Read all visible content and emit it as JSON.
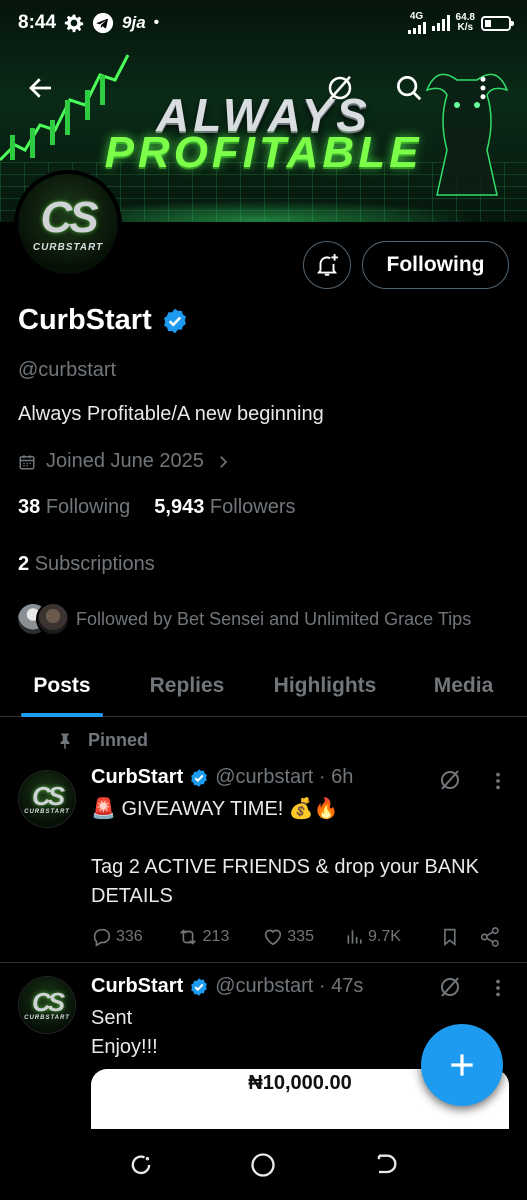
{
  "status_bar": {
    "time": "8:44",
    "app_badge": "9ja",
    "dot": "•",
    "network_top": "4G",
    "speed_value": "64.8",
    "speed_unit": "K/s",
    "icons": [
      "gear-icon",
      "telegram-icon",
      "signal-icon",
      "battery-icon"
    ]
  },
  "header": {
    "banner_line1": "ALWAYS",
    "banner_line2": "PROFITABLE",
    "icons": [
      "back-arrow-icon",
      "grok-icon",
      "search-icon",
      "more-vertical-icon"
    ]
  },
  "profile": {
    "logo_text": "CS",
    "logo_word": "CURBSTART",
    "name": "CurbStart",
    "handle": "@curbstart",
    "bio": "Always Profitable/A new beginning",
    "joined": "Joined June 2025",
    "following_count": "38",
    "following_label": "Following",
    "followers_count": "5,943",
    "followers_label": "Followers",
    "subscriptions_count": "2",
    "subscriptions_label": "Subscriptions",
    "followed_by": "Followed by Bet Sensei and Unlimited Grace Tips",
    "follow_button": "Following",
    "colors": {
      "accent": "#1d9bf0",
      "verified": "#1d9bf0",
      "muted": "#71767b",
      "banner_green": "#7dff4a"
    }
  },
  "tabs": [
    {
      "label": "Posts",
      "active": true
    },
    {
      "label": "Replies",
      "active": false
    },
    {
      "label": "Highlights",
      "active": false
    },
    {
      "label": "Media",
      "active": false
    }
  ],
  "posts": [
    {
      "pinned_label": "Pinned",
      "name": "CurbStart",
      "handle": "@curbstart · 6h",
      "line1": "🚨 GIVEAWAY TIME! 💰🔥",
      "line2": "Tag 2 ACTIVE FRIENDS & drop your BANK",
      "line3": "DETAILS",
      "replies": "336",
      "reposts": "213",
      "likes": "335",
      "views": "9.7K"
    },
    {
      "name": "CurbStart",
      "handle": "@curbstart · 47s",
      "line1": "Sent",
      "line2": "Enjoy!!!",
      "card_amount": "₦10,000.00"
    }
  ],
  "fab": {
    "icon": "plus-icon"
  },
  "system_nav": {
    "icons": [
      "recents-icon",
      "home-circle-icon",
      "back-nav-icon"
    ]
  }
}
